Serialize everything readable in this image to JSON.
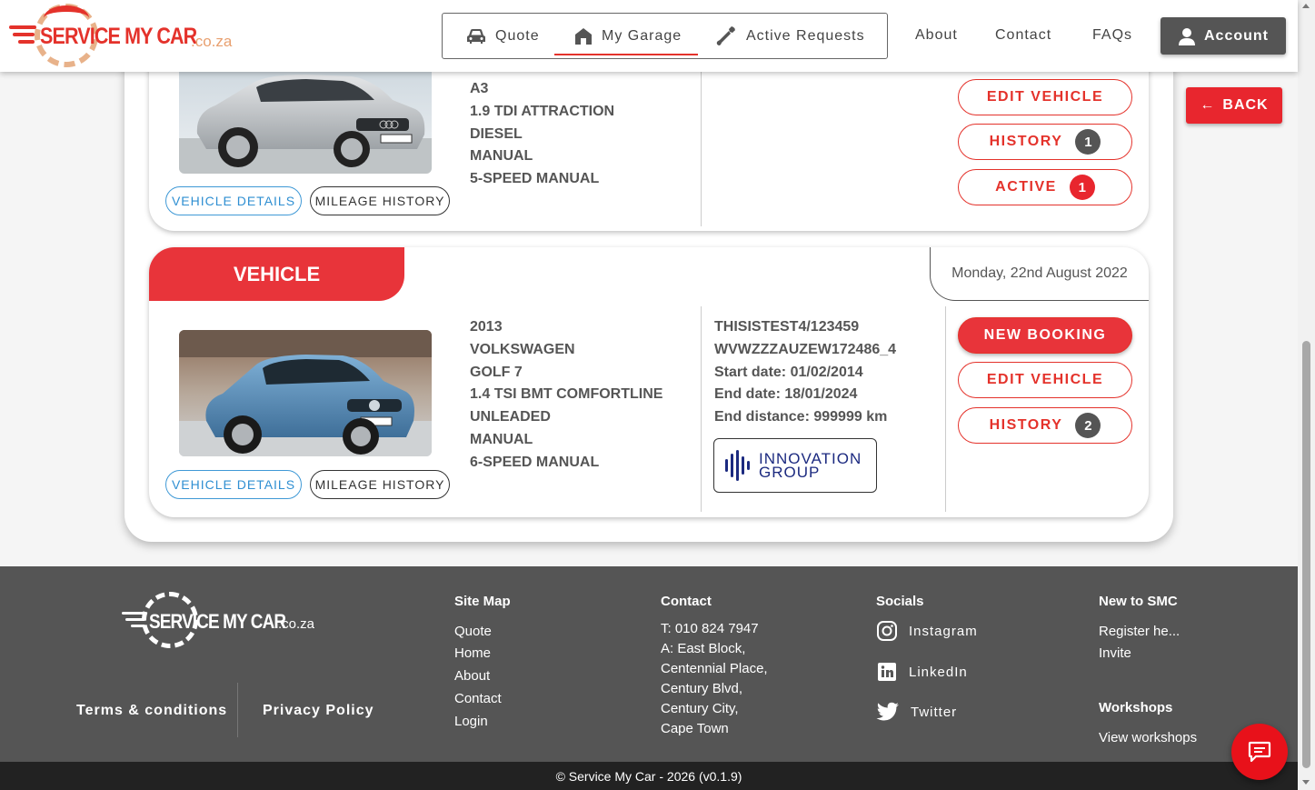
{
  "brand": {
    "name": "SERVICE MY CAR",
    "tld": ".co.za"
  },
  "nav": {
    "quote": "Quote",
    "my_garage": "My Garage",
    "active_requests": "Active Requests",
    "about": "About",
    "contact": "Contact",
    "faqs": "FAQs",
    "account": "Account",
    "back": "BACK"
  },
  "vehicles": [
    {
      "specs": [
        "A3",
        "1.9 TDI ATTRACTION",
        "DIESEL",
        "MANUAL",
        "5-SPEED MANUAL"
      ],
      "details_label": "VEHICLE DETAILS",
      "mileage_label": "MILEAGE HISTORY",
      "actions": {
        "edit": "EDIT VEHICLE",
        "history": "HISTORY",
        "history_count": "1",
        "active": "ACTIVE",
        "active_count": "1"
      }
    },
    {
      "tab_label": "VEHICLE",
      "date": "Monday, 22nd August 2022",
      "specs": [
        "2013",
        "VOLKSWAGEN",
        "GOLF 7",
        "1.4 TSI BMT COMFORTLINE",
        "UNLEADED",
        "MANUAL",
        "6-SPEED MANUAL"
      ],
      "plan": [
        "THISISTEST4/123459",
        "WVWZZZAUZEW172486_4",
        "Start date: 01/02/2014",
        "End date: 18/01/2024",
        "End distance: 999999 km"
      ],
      "provider_line1": "INNOVATION",
      "provider_line2": "GROUP",
      "details_label": "VEHICLE DETAILS",
      "mileage_label": "MILEAGE HISTORY",
      "actions": {
        "new_booking": "NEW BOOKING",
        "edit": "EDIT VEHICLE",
        "history": "HISTORY",
        "history_count": "2"
      }
    }
  ],
  "footer": {
    "terms": "Terms & conditions",
    "privacy": "Privacy Policy",
    "sitemap": {
      "title": "Site Map",
      "items": [
        "Quote",
        "Home",
        "About",
        "Contact",
        "Login"
      ]
    },
    "contact": {
      "title": "Contact",
      "lines": [
        "T: 010 824 7947",
        "A: East Block,",
        "Centennial Place,",
        "Century Blvd,",
        "Century City,",
        "Cape Town"
      ]
    },
    "socials": {
      "title": "Socials",
      "items": [
        "Instagram",
        "LinkedIn",
        "Twitter"
      ]
    },
    "new_to_smc": {
      "title": "New to SMC",
      "items": [
        "Register he...",
        "Invite"
      ]
    },
    "workshops": {
      "title": "Workshops",
      "items": [
        "View workshops"
      ]
    },
    "copyright": "© Service My Car - 2026 (v0.1.9)"
  },
  "colors": {
    "accent": "#e8343a",
    "dark": "#555555",
    "link_blue": "#2f8fd2"
  }
}
